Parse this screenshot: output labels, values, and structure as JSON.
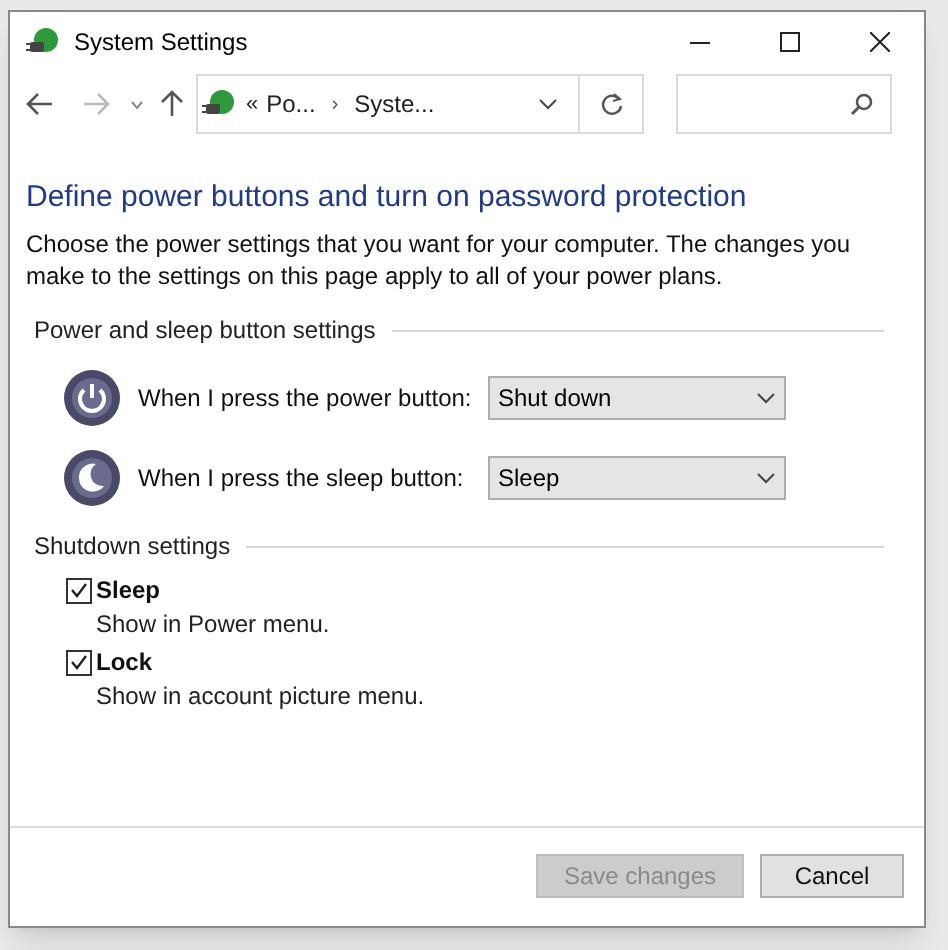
{
  "window": {
    "title": "System Settings"
  },
  "address_bar": {
    "overflow": "«",
    "crumbs": [
      "Po...",
      "Syste..."
    ],
    "separator": "›"
  },
  "page": {
    "heading": "Define power buttons and turn on password protection",
    "description": "Choose the power settings that you want for your computer. The changes you make to the settings on this page apply to all of your power plans."
  },
  "button_settings": {
    "title": "Power and sleep button settings",
    "rows": [
      {
        "kind": "power",
        "label": "When I press the power button:",
        "value": "Shut down"
      },
      {
        "kind": "sleep",
        "label": "When I press the sleep button:",
        "value": "Sleep"
      }
    ]
  },
  "shutdown_settings": {
    "title": "Shutdown settings",
    "items": [
      {
        "label": "Sleep",
        "description": "Show in Power menu.",
        "checked": true
      },
      {
        "label": "Lock",
        "description": "Show in account picture menu.",
        "checked": true
      }
    ]
  },
  "buttons": [
    {
      "label": "Save changes",
      "disabled": true
    },
    {
      "label": "Cancel",
      "disabled": false
    }
  ]
}
